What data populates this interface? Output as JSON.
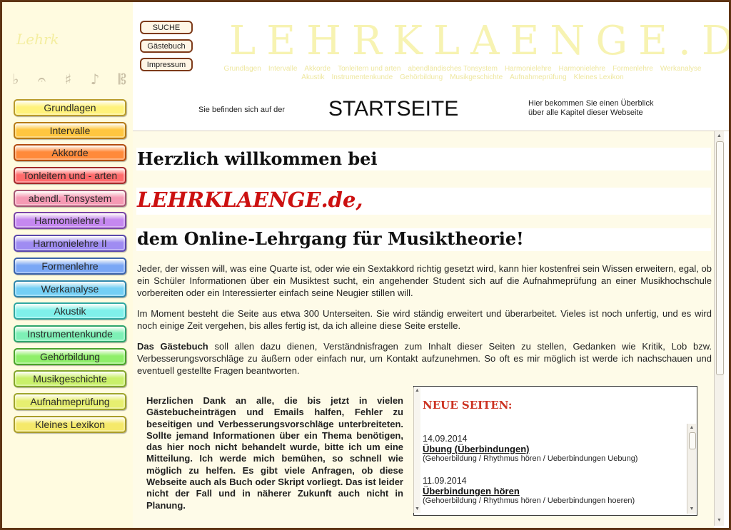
{
  "left": {
    "logo_faint": "Lehrk",
    "symbols": [
      "♭",
      "𝄐",
      "♯",
      "♪",
      "𝄡"
    ],
    "nav": [
      {
        "label": "Grundlagen",
        "color": "#fff27a",
        "border": "#b99a2a"
      },
      {
        "label": "Intervalle",
        "color": "#ffc640",
        "border": "#b77a14"
      },
      {
        "label": "Akkorde",
        "color": "#ff8a3a",
        "border": "#b34d10"
      },
      {
        "label": "Tonleitern und - arten",
        "color": "#ff6b6b",
        "border": "#a32b2b"
      },
      {
        "label": "abendl. Tonsystem",
        "color": "#f59ab4",
        "border": "#a45572"
      },
      {
        "label": "Harmonielehre I",
        "color": "#c588f0",
        "border": "#7a44a6"
      },
      {
        "label": "Harmonielehre II",
        "color": "#9f8cf2",
        "border": "#5a47ab"
      },
      {
        "label": "Formenlehre",
        "color": "#7aa7f5",
        "border": "#3b63aa"
      },
      {
        "label": "Werkanalyse",
        "color": "#73cff5",
        "border": "#2f87ad"
      },
      {
        "label": "Akustik",
        "color": "#7ff0ea",
        "border": "#2fa8a2"
      },
      {
        "label": "Instrumentenkunde",
        "color": "#7ef0b6",
        "border": "#2ea56c"
      },
      {
        "label": "Gehörbildung",
        "color": "#8fef6a",
        "border": "#4aa32a"
      },
      {
        "label": "Musikgeschichte",
        "color": "#c9f06a",
        "border": "#84a62a"
      },
      {
        "label": "Aufnahmeprüfung",
        "color": "#e6ef70",
        "border": "#9fa52a"
      },
      {
        "label": "Kleines Lexikon",
        "color": "#f5e96a",
        "border": "#aa9d2a"
      }
    ]
  },
  "top_buttons": {
    "suche": "SUCHE",
    "gaestebuch": "Gästebuch",
    "impressum": "Impressum"
  },
  "header": {
    "site_title": "LEHRKLAENGE.DE",
    "faint_links_row1": [
      "Grundlagen",
      "Intervalle",
      "Akkorde",
      "Tonleitern und arten",
      "abendländisches Tonsystem",
      "Harmonielehre",
      "Harmonielehre",
      "Formenlehre",
      "Werkanalyse"
    ],
    "faint_links_row2": [
      "Akustik",
      "Instrumentenkunde",
      "Gehörbildung",
      "Musikgeschichte",
      "Aufnahmeprüfung",
      "Kleines Lexikon"
    ],
    "location_label": "Sie befinden sich auf der",
    "location_page": "STARTSEITE",
    "location_desc_1": "Hier bekommen Sie einen Überblick",
    "location_desc_2": "über alle Kapitel dieser Webseite"
  },
  "content": {
    "welcome_1": "Herzlich willkommen bei",
    "welcome_2": "LEHRKLAENGE.de,",
    "welcome_3": "dem Online-Lehrgang für Musiktheorie!",
    "p1": "Jeder, der wissen will, was eine Quarte ist, oder wie ein Sextakkord richtig gesetzt wird, kann hier kostenfrei sein Wissen erweitern, egal, ob ein Schüler Informationen über ein Musiktest sucht, ein angehender Student sich auf die Aufnahmeprüfung an einer Musikhochschule vorbereiten oder ein Interessierter einfach seine Neugier stillen will.",
    "p2": "Im Moment besteht die Seite aus etwa 300 Unterseiten. Sie wird ständig erweitert und überarbeitet. Vieles ist noch unfertig, und es wird noch einige Zeit vergehen, bis alles fertig ist, da ich alleine diese Seite erstelle.",
    "p3_bold": "Das Gästebuch",
    "p3_rest": " soll allen dazu dienen, Verständnisfragen zum Inhalt dieser Seiten zu stellen, Gedanken wie Kritik, Lob bzw. Verbesserungsvorschläge zu äußern oder einfach nur, um Kontakt aufzunehmen. So oft es mir möglich ist werde ich nachschauen und eventuell gestellte Fragen beantworten.",
    "thanks": "Herzlichen Dank an alle, die bis jetzt in vielen Gästebucheinträgen und Emails halfen, Fehler zu beseitigen und Verbesserungsvorschläge unterbreiteten. Sollte jemand Informationen über ein Thema benötigen, das hier noch nicht behandelt wurde, bitte ich um eine Mitteilung. Ich werde mich bemühen, so schnell wie möglich zu helfen. Es gibt viele Anfragen, ob diese Webseite auch als Buch oder Skript vorliegt. Das ist leider nicht der Fall und in näherer Zukunft auch nicht in Planung."
  },
  "news": {
    "title": "NEUE SEITEN:",
    "entries": [
      {
        "date": "14.09.2014",
        "link": "Übung (Überbindungen)",
        "path": "(Gehoerbildung / Rhythmus hören / Ueberbindungen Uebung)"
      },
      {
        "date": "11.09.2014",
        "link": "Überbindungen hören",
        "path": "(Gehoerbildung / Rhythmus hören / Ueberbindungen hoeren)"
      }
    ]
  }
}
